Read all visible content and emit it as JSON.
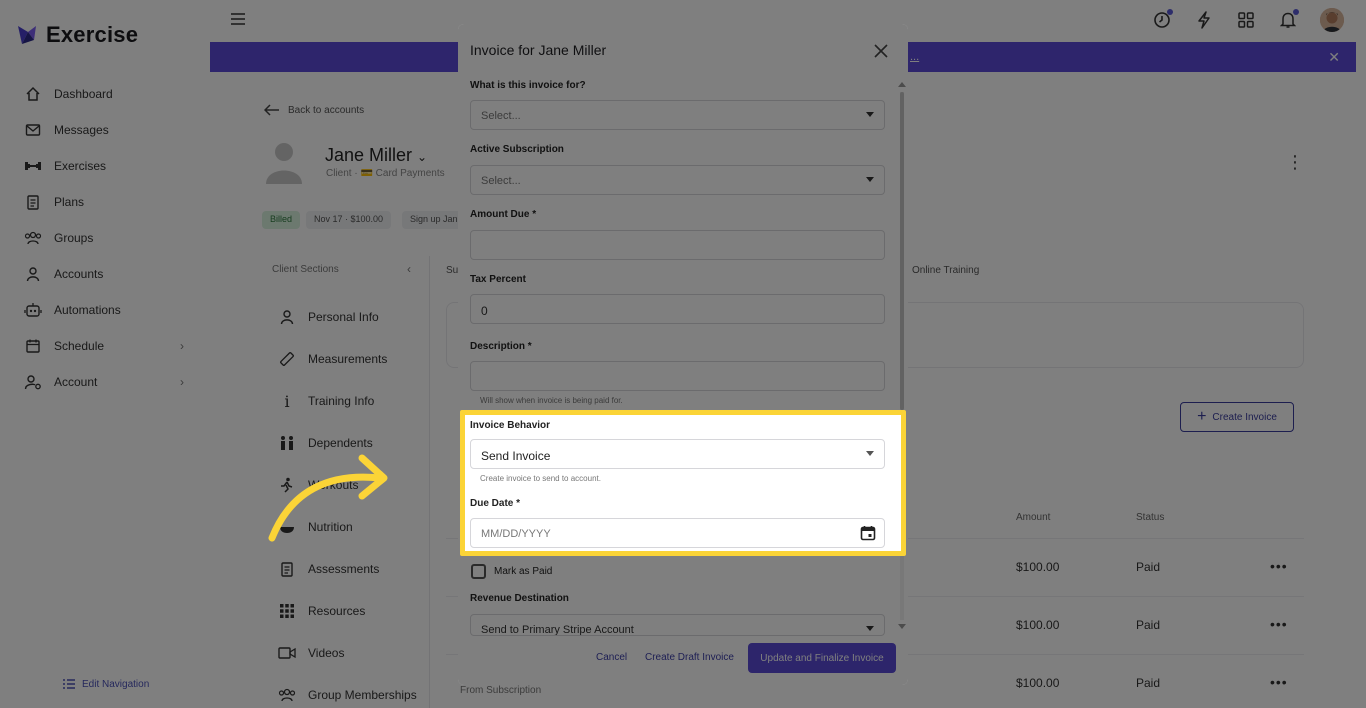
{
  "app": {
    "name": "Exercise"
  },
  "sidebar": {
    "items": [
      {
        "label": "Dashboard",
        "icon": "home-icon"
      },
      {
        "label": "Messages",
        "icon": "mail-icon"
      },
      {
        "label": "Exercises",
        "icon": "dumbbell-icon"
      },
      {
        "label": "Plans",
        "icon": "clipboard-icon"
      },
      {
        "label": "Groups",
        "icon": "users-icon"
      },
      {
        "label": "Accounts",
        "icon": "user-icon"
      },
      {
        "label": "Automations",
        "icon": "robot-icon"
      },
      {
        "label": "Schedule",
        "icon": "calendar-icon"
      },
      {
        "label": "Account",
        "icon": "user-gear-icon"
      }
    ],
    "edit_nav": "Edit Navigation"
  },
  "banner": {
    "link_text": "...",
    "close": "✕"
  },
  "page": {
    "back_link": "Back to accounts",
    "client_name": "Jane Miller",
    "client_sub": "Client · 💳 Card Payments",
    "pills": [
      "Billed",
      "Nov 17 · $100.00",
      "Sign up Jan"
    ],
    "sections_title": "Client Sections",
    "sections": [
      "Personal Info",
      "Measurements",
      "Training Info",
      "Dependents",
      "Workouts",
      "Nutrition",
      "Assessments",
      "Resources",
      "Videos",
      "Group Memberships"
    ],
    "tab_online": "Online Training",
    "tab_su": "Su",
    "create_invoice": "Create Invoice",
    "columns": {
      "amount": "Amount",
      "status": "Status"
    },
    "rows": [
      {
        "amount": "$100.00",
        "status": "Paid",
        "more": "•••"
      },
      {
        "amount": "$100.00",
        "status": "Paid",
        "more": "•••"
      },
      {
        "amount": "$100.00",
        "status": "Paid",
        "more": "•••"
      }
    ],
    "from_subscription": "From Subscription"
  },
  "modal": {
    "title": "Invoice for Jane Miller",
    "fields": {
      "purpose": {
        "label": "What is this invoice for?",
        "placeholder": "Select..."
      },
      "subscription": {
        "label": "Active Subscription",
        "placeholder": "Select..."
      },
      "amount": {
        "label": "Amount Due *",
        "value": ""
      },
      "tax": {
        "label": "Tax Percent",
        "value": "0"
      },
      "description": {
        "label": "Description *",
        "value": "",
        "helper": "Will show when invoice is being paid for."
      },
      "behavior": {
        "label": "Invoice Behavior",
        "value": "Send Invoice",
        "helper": "Create invoice to send to account."
      },
      "due_date": {
        "label": "Due Date *",
        "placeholder": "MM/DD/YYYY"
      },
      "mark_paid": {
        "label": "Mark as Paid"
      },
      "revenue": {
        "label": "Revenue Destination",
        "value": "Send to Primary Stripe Account"
      }
    },
    "buttons": {
      "cancel": "Cancel",
      "draft": "Create Draft Invoice",
      "finalize": "Update and Finalize Invoice"
    }
  },
  "colors": {
    "accent": "#5a4ad6",
    "highlight": "#fbd437",
    "banner": "#5c4ad9"
  }
}
